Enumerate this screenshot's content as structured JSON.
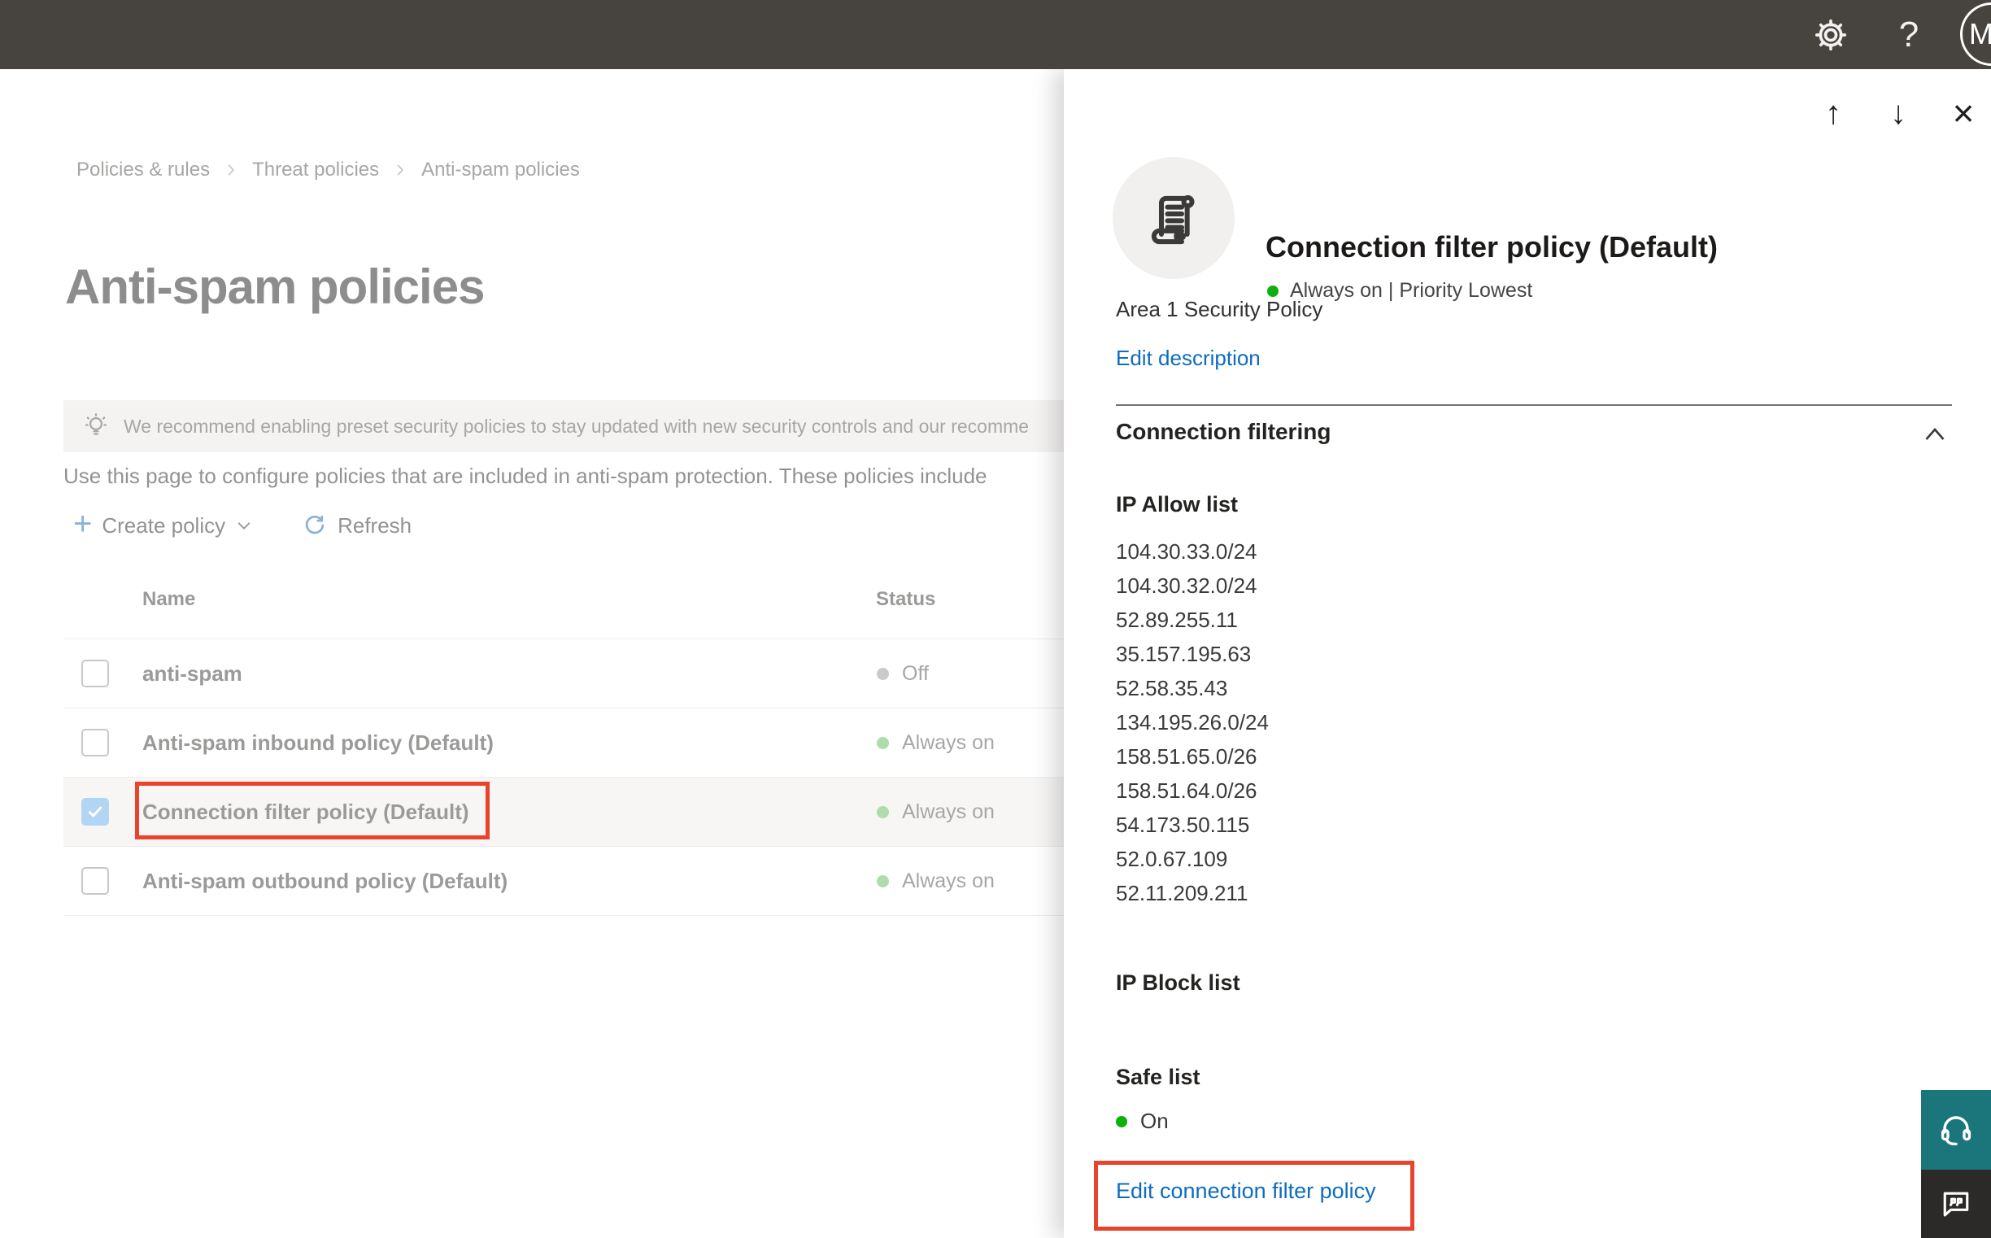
{
  "topbar": {
    "avatar_initial": "M",
    "help_label": "?"
  },
  "breadcrumb": {
    "items": [
      "Policies & rules",
      "Threat policies",
      "Anti-spam policies"
    ]
  },
  "main": {
    "title": "Anti-spam policies",
    "banner_text": "We recommend enabling preset security policies to stay updated with new security controls and our recomme",
    "intro_text": "Use this page to configure policies that are included in anti-spam protection. These policies include",
    "toolbar": {
      "create_label": "Create policy",
      "refresh_label": "Refresh"
    },
    "table": {
      "columns": {
        "name": "Name",
        "status": "Status"
      },
      "rows": [
        {
          "name": "anti-spam",
          "status": "Off",
          "status_color": "gray",
          "checked": false,
          "selected": false
        },
        {
          "name": "Anti-spam inbound policy (Default)",
          "status": "Always on",
          "status_color": "green",
          "checked": false,
          "selected": false
        },
        {
          "name": "Connection filter policy (Default)",
          "status": "Always on",
          "status_color": "green",
          "checked": true,
          "selected": true
        },
        {
          "name": "Anti-spam outbound policy (Default)",
          "status": "Always on",
          "status_color": "green",
          "checked": false,
          "selected": false
        }
      ]
    }
  },
  "flyout": {
    "title": "Connection filter policy (Default)",
    "status_line": "Always on | Priority Lowest",
    "description": "Area 1 Security Policy",
    "edit_description_label": "Edit description",
    "section_label": "Connection filtering",
    "ip_allow": {
      "label": "IP Allow list",
      "items": [
        "104.30.33.0/24",
        "104.30.32.0/24",
        "52.89.255.11",
        "35.157.195.63",
        "52.58.35.43",
        "134.195.26.0/24",
        "158.51.65.0/26",
        "158.51.64.0/26",
        "54.173.50.115",
        "52.0.67.109",
        "52.11.209.211"
      ]
    },
    "ip_block": {
      "label": "IP Block list"
    },
    "safe_list": {
      "label": "Safe list",
      "value": "On"
    },
    "edit_link_label": "Edit connection filter policy"
  },
  "colors": {
    "topbar_bg": "#474440",
    "link_blue": "#0f6cbd",
    "annotation_red": "#e8432d",
    "status_green": "#6cc067",
    "status_green_bright": "#0faf0f",
    "status_gray": "#a19f9d",
    "checkbox_blue": "#74b2ec",
    "support_teal": "#1b767c",
    "feedback_dark": "#2b2a28"
  }
}
